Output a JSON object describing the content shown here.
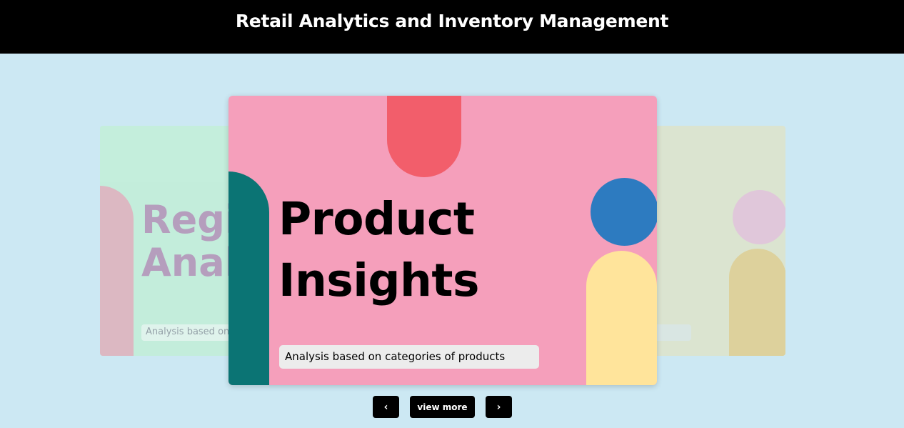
{
  "header": {
    "title": "Retail Analytics and Inventory Management"
  },
  "carousel": {
    "left_card": {
      "title": "Regi\nAnaly",
      "subtitle": "Analysis based on ro",
      "colors": {
        "background": "#c3eed9",
        "title": "#b396b8",
        "arch": "#deb3bd"
      }
    },
    "center_card": {
      "title": "Product\nInsights",
      "subtitle": "Analysis based on categories of products",
      "colors": {
        "background": "#f59fbb",
        "top_tab": "#f25e6b",
        "teal_arch": "#0b7474",
        "blue_circle": "#2d7bc0",
        "yellow_arch": "#ffe49b"
      }
    },
    "right_card": {
      "colors": {
        "background": "#dbe4d0",
        "circle": "#e0c7da",
        "arch": "#ddd19c"
      }
    }
  },
  "controls": {
    "prev_label": "‹",
    "view_more_label": "view more",
    "next_label": "›"
  },
  "colors": {
    "page_background": "#cce8f3",
    "header_background": "#000000",
    "button_background": "#000000"
  }
}
